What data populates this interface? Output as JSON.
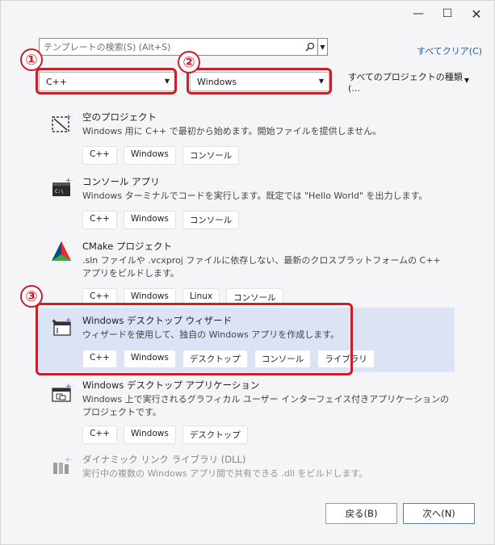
{
  "titlebar": {
    "minimize": "—",
    "maximize": "☐",
    "close": "✕"
  },
  "search": {
    "placeholder": "テンプレートの検索(S) (Alt+S)"
  },
  "clear_all": "すべてクリア(C)",
  "filters": {
    "language": "C++",
    "platform": "Windows",
    "project_type": "すべてのプロジェクトの種類(..."
  },
  "annotations": [
    "①",
    "②",
    "③"
  ],
  "templates": [
    {
      "title": "空のプロジェクト",
      "desc": "Windows 用に C++ で最初から始めます。開始ファイルを提供しません。",
      "tags": [
        "C++",
        "Windows",
        "コンソール"
      ]
    },
    {
      "title": "コンソール アプリ",
      "desc": "Windows ターミナルでコードを実行します。既定では \"Hello World\" を出力します。",
      "tags": [
        "C++",
        "Windows",
        "コンソール"
      ]
    },
    {
      "title": "CMake プロジェクト",
      "desc": ".sln ファイルや .vcxproj ファイルに依存しない、最新のクロスプラットフォームの C++ アプリをビルドします。",
      "tags": [
        "C++",
        "Windows",
        "Linux",
        "コンソール"
      ]
    },
    {
      "title": "Windows デスクトップ ウィザード",
      "desc": "ウィザードを使用して、独自の Windows アプリを作成します。",
      "tags": [
        "C++",
        "Windows",
        "デスクトップ",
        "コンソール",
        "ライブラリ"
      ]
    },
    {
      "title": "Windows デスクトップ アプリケーション",
      "desc": "Windows 上で実行されるグラフィカル ユーザー インターフェイス付きアプリケーションのプロジェクトです。",
      "tags": [
        "C++",
        "Windows",
        "デスクトップ"
      ]
    },
    {
      "title": "ダイナミック リンク ライブラリ (DLL)",
      "desc": "実行中の複数の Windows アプリ間で共有できる .dll をビルドします。",
      "tags": []
    }
  ],
  "buttons": {
    "back": "戻る(B)",
    "next": "次へ(N)"
  },
  "colors": {
    "highlight": "#c91f28",
    "selected_bg": "#dbe3f5",
    "link": "#1a5fb4"
  }
}
